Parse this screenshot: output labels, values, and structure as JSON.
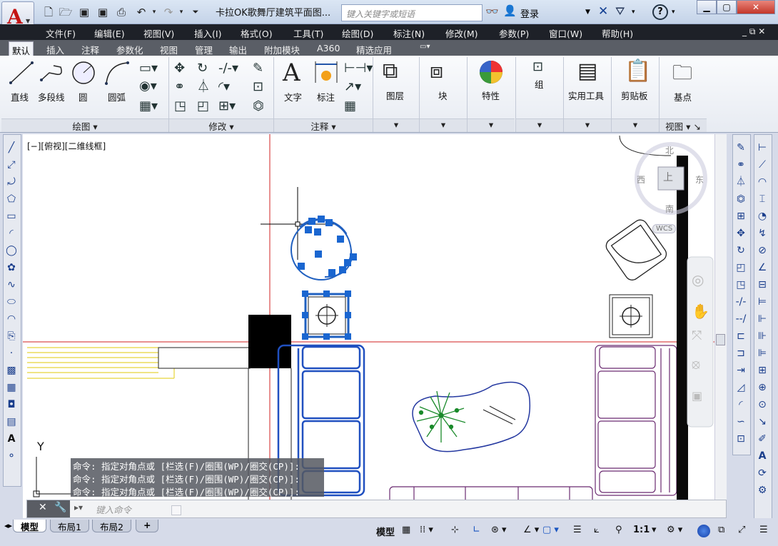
{
  "app": {
    "logo": "A",
    "title": "卡拉OK歌舞厅建筑平面图...",
    "search_placeholder": "键入关键字或短语",
    "login": "登录",
    "help": "?"
  },
  "menus": [
    "文件(F)",
    "编辑(E)",
    "视图(V)",
    "插入(I)",
    "格式(O)",
    "工具(T)",
    "绘图(D)",
    "标注(N)",
    "修改(M)",
    "参数(P)",
    "窗口(W)",
    "帮助(H)"
  ],
  "ribbon_tabs": [
    "默认",
    "插入",
    "注释",
    "参数化",
    "视图",
    "管理",
    "输出",
    "附加模块",
    "A360",
    "精选应用"
  ],
  "draw_panel": {
    "tools": [
      "直线",
      "多段线",
      "圆",
      "圆弧"
    ],
    "footer": "绘图"
  },
  "modify_panel": {
    "footer": "修改"
  },
  "annot_panel": {
    "tools": [
      "文字",
      "标注"
    ],
    "footer": "注释"
  },
  "big_tools": [
    "图层",
    "块",
    "特性",
    "组",
    "实用工具",
    "剪贴板",
    "基点"
  ],
  "view_footer": "视图",
  "viewport_label": "[−][俯视][二维线框]",
  "viewcube": {
    "north": "北",
    "south": "南",
    "east": "东",
    "west": "西",
    "top": "上",
    "wcs": "WCS"
  },
  "ucs_y": "Y",
  "command_history": [
    "命令: 指定对角点或 [栏选(F)/圈围(WP)/圈交(CP)]:",
    "命令: 指定对角点或 [栏选(F)/圈围(WP)/圈交(CP)]:",
    "命令: 指定对角点或 [栏选(F)/圈围(WP)/圈交(CP)]:"
  ],
  "command_placeholder": "键入命令",
  "layout_tabs": [
    "模型",
    "布局1",
    "布局2",
    "+"
  ],
  "status": {
    "model": "模型",
    "scale": "1:1"
  }
}
